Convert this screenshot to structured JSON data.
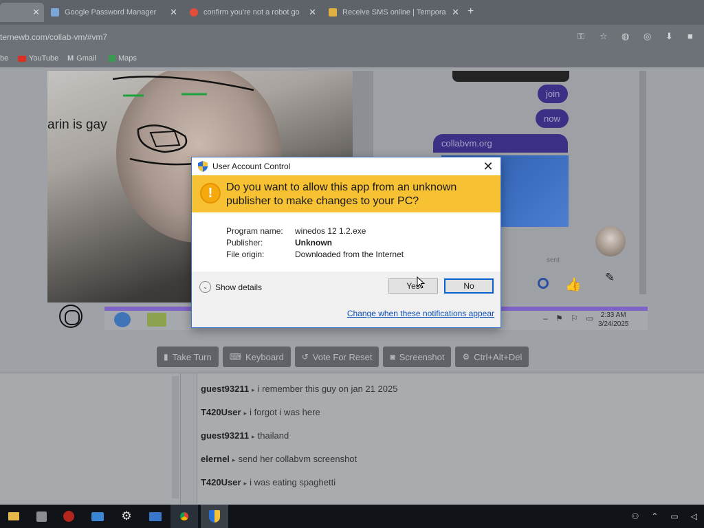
{
  "browser": {
    "tabs": [
      {
        "label": "Google Password Manager",
        "favicon_color": "#7aa7d8"
      },
      {
        "label": "confirm you're not a robot go",
        "favicon_color": "#e44d3a"
      },
      {
        "label": "Receive SMS online | Tempora",
        "favicon_color": "#e0b142"
      }
    ],
    "new_tab": "+",
    "url": "ternewb.com/collab-vm/#vm7",
    "bookmarks": [
      {
        "label": "be",
        "color": "#888888"
      },
      {
        "label": "YouTube",
        "color": "#d93025"
      },
      {
        "label": "Gmail",
        "color": "#c5c9cc"
      },
      {
        "label": "Maps",
        "color": "#3b9a52"
      }
    ]
  },
  "vm_screen": {
    "overlay_text": "arin is gay",
    "chat_bubbles": [
      "join",
      "now",
      "collabvm.org"
    ],
    "sent_label": "sent",
    "clock_time": "2:33 AM",
    "clock_date": "3/24/2025"
  },
  "vm_controls": {
    "buttons": [
      {
        "label": "Take Turn",
        "icon": "trash-icon"
      },
      {
        "label": "Keyboard",
        "icon": "keyboard-icon"
      },
      {
        "label": "Vote For Reset",
        "icon": "rotate-icon"
      },
      {
        "label": "Screenshot",
        "icon": "camera-icon"
      },
      {
        "label": "Ctrl+Alt+Del",
        "icon": "gear-icon"
      }
    ]
  },
  "chat_log": [
    {
      "user": "guest93211",
      "text": "i remember this guy on jan 21 2025"
    },
    {
      "user": "T420User",
      "text": "i forgot i was here"
    },
    {
      "user": "guest93211",
      "text": "thailand"
    },
    {
      "user": "elernel",
      "text": "send her collabvm screenshot"
    },
    {
      "user": "T420User",
      "text": "i was eating spaghetti"
    }
  ],
  "uac": {
    "title": "User Account Control",
    "question": "Do you want to allow this app from an unknown publisher to make changes to your PC?",
    "program_label": "Program name:",
    "program_value": "winedos 12 1.2.exe",
    "publisher_label": "Publisher:",
    "publisher_value": "Unknown",
    "origin_label": "File origin:",
    "origin_value": "Downloaded from the Internet",
    "show_details": "Show details",
    "yes_label": "Yes",
    "no_label": "No",
    "change_link": "Change when these notifications appear",
    "banner_color": "#f6c133"
  },
  "taskbar": {
    "apps": [
      "file-explorer-icon",
      "store-icon",
      "record-icon",
      "mail-icon",
      "settings-icon",
      "terminal-icon",
      "chrome-icon",
      "uac-shield-icon"
    ]
  }
}
